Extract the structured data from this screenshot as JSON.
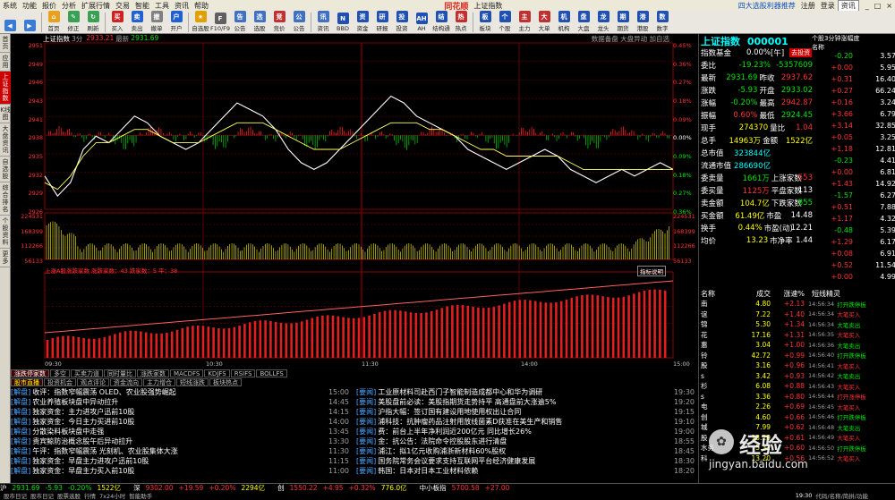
{
  "menubar": {
    "items": [
      "系统",
      "功能",
      "报价",
      "分析",
      "扩展行情",
      "交易",
      "智能",
      "工具",
      "资讯",
      "帮助"
    ],
    "logo": "同花顺",
    "title": "上证指数",
    "promo": "四大选股利器推荐",
    "right": [
      "注册",
      "登录"
    ],
    "search": "资讯"
  },
  "toolbar": {
    "buttons": [
      {
        "label": "",
        "name": "back-button",
        "color": "#3a7bd5",
        "glyph": "◀"
      },
      {
        "label": "",
        "name": "forward-button",
        "color": "#3a7bd5",
        "glyph": "▶"
      },
      {
        "label": "首页",
        "name": "home-button",
        "color": "#e8a020",
        "glyph": "⌂"
      },
      {
        "label": "修正",
        "name": "correct-button",
        "color": "#3aa055",
        "glyph": "✎"
      },
      {
        "label": "刷新",
        "name": "refresh-button",
        "color": "#3aa055",
        "glyph": "↻"
      },
      {
        "label": "买入",
        "name": "buy-button",
        "color": "#d02020",
        "glyph": "买"
      },
      {
        "label": "卖出",
        "name": "sell-button",
        "color": "#2060d0",
        "glyph": "卖"
      },
      {
        "label": "撤单",
        "name": "cancel-order-button",
        "color": "#808080",
        "glyph": "撤"
      },
      {
        "label": "开户",
        "name": "open-account-button",
        "color": "#2060d0",
        "glyph": "户"
      },
      {
        "label": "自选股",
        "name": "watchlist-button",
        "color": "#e0a000",
        "glyph": "★"
      },
      {
        "label": "F10/F9",
        "name": "f10-button",
        "color": "#606060",
        "glyph": "F"
      },
      {
        "label": "公告",
        "name": "announcement-button",
        "color": "#4070c0",
        "glyph": "告"
      },
      {
        "label": "选股",
        "name": "stock-picker-button",
        "color": "#4070c0",
        "glyph": "选"
      },
      {
        "label": "竞价",
        "name": "auction-button",
        "color": "#c03030",
        "glyph": "竞"
      },
      {
        "label": "公告",
        "name": "notice-button",
        "color": "#4070c0",
        "glyph": "公"
      },
      {
        "label": "资讯",
        "name": "info-button",
        "color": "#4070c0",
        "glyph": "讯"
      },
      {
        "label": "BBD",
        "name": "news-bbd-button",
        "color": "#2050b0",
        "glyph": "N"
      },
      {
        "label": "资金",
        "name": "funds-button",
        "color": "#2050b0",
        "glyph": "资"
      },
      {
        "label": "研报",
        "name": "report-button",
        "color": "#2050b0",
        "glyph": "研"
      },
      {
        "label": "投资",
        "name": "invest-button",
        "color": "#2050b0",
        "glyph": "投"
      },
      {
        "label": "AH",
        "name": "ah-button",
        "color": "#2050b0",
        "glyph": "AH"
      },
      {
        "label": "结构通",
        "name": "structure-button",
        "color": "#2050b0",
        "glyph": "结"
      },
      {
        "label": "热点",
        "name": "hotspot-button",
        "color": "#c03030",
        "glyph": "热"
      },
      {
        "label": "板块",
        "name": "sector-button",
        "color": "#2050b0",
        "glyph": "板"
      },
      {
        "label": "个股",
        "name": "stock-button",
        "color": "#2050b0",
        "glyph": "个"
      },
      {
        "label": "主力",
        "name": "main-force-button",
        "color": "#c03030",
        "glyph": "主"
      },
      {
        "label": "大单",
        "name": "big-order-button",
        "color": "#c03030",
        "glyph": "大"
      },
      {
        "label": "机构",
        "name": "institution-button",
        "color": "#2050b0",
        "glyph": "机"
      },
      {
        "label": "大盘",
        "name": "market-button",
        "color": "#2050b0",
        "glyph": "盘"
      },
      {
        "label": "龙头",
        "name": "leader-button",
        "color": "#2050b0",
        "glyph": "龙"
      },
      {
        "label": "期货",
        "name": "futures-button",
        "color": "#2050b0",
        "glyph": "期"
      },
      {
        "label": "港股",
        "name": "hk-button",
        "color": "#2050b0",
        "glyph": "港"
      },
      {
        "label": "数字",
        "name": "digital-button",
        "color": "#2050b0",
        "glyph": "数"
      }
    ]
  },
  "lefttabs": [
    {
      "label": "首页",
      "active": false
    },
    {
      "label": "应用",
      "active": false
    },
    {
      "label": "上证指数",
      "active": true
    },
    {
      "label": "K线图",
      "active": false
    },
    {
      "label": "大盘资讯",
      "active": false
    },
    {
      "label": "自选股",
      "active": false
    },
    {
      "label": "综合排名",
      "active": false
    },
    {
      "label": "个股资料",
      "active": false
    },
    {
      "label": "更多",
      "active": false
    }
  ],
  "chart_header": {
    "title": "上证指数",
    "period": "3分",
    "value": "2933.21",
    "latest_label": "最新",
    "latest": "2931.69",
    "right": "数据备盘 大盘异动 加自选"
  },
  "price_axis": {
    "left": [
      "2951",
      "2949",
      "2946",
      "2943",
      "2941",
      "2938",
      "2935",
      "2932",
      "2929",
      "2926"
    ],
    "right": [
      "0.45%",
      "0.36%",
      "0.27%",
      "0.18%",
      "0.09%",
      "0.00%",
      "0.09%",
      "0.18%",
      "0.27%",
      "0.36%"
    ]
  },
  "volume_axis": {
    "left": [
      "224531",
      "168399",
      "112266",
      "56133"
    ],
    "right": [
      "224531",
      "168399",
      "112266",
      "56133"
    ]
  },
  "indicator_header": {
    "text": "上涨A股涨跌家数 涨跌家数：43 跌家数：5 平：38",
    "button": "指标说明"
  },
  "time_axis": [
    "09:30",
    "10:30",
    "11:30",
    "14:00",
    "15:00"
  ],
  "chart_data": {
    "type": "line",
    "series": [
      {
        "name": "",
        "values": [
          2931,
          2928,
          2930,
          2935,
          2937,
          2936,
          2938,
          2940,
          2939,
          2937,
          2936,
          2935,
          2936,
          2938,
          2940,
          2942,
          2941,
          2940,
          2938,
          2935,
          2933,
          2932,
          2933,
          2935,
          2937,
          2939,
          2941,
          2943,
          2942,
          2940,
          2939,
          2938,
          2937,
          2935,
          2934,
          2933,
          2932,
          2933,
          2934,
          2935,
          2934,
          2932,
          2931,
          2930,
          2931,
          2932,
          2931,
          2932,
          2933,
          2932
        ]
      },
      {
        "name": "",
        "values": [
          2930,
          2929,
          2931,
          2934,
          2936,
          2936,
          2937,
          2938,
          2938,
          2937,
          2936,
          2936,
          2936,
          2937,
          2938,
          2939,
          2939,
          2939,
          2938,
          2937,
          2936,
          2935,
          2935,
          2935,
          2936,
          2937,
          2938,
          2939,
          2939,
          2939,
          2938,
          2938,
          2937,
          2936,
          2935,
          2935,
          2934,
          2934,
          2934,
          2934,
          2934,
          2933,
          2932,
          2932,
          2932,
          2932,
          2932,
          2932,
          2932,
          2932
        ]
      }
    ],
    "ylim": [
      2926,
      2951
    ]
  },
  "bottom_tabs": [
    "涨跌停家数",
    "多空",
    "买卖力道",
    "同时量比",
    "涨跌家数",
    "MACDFS",
    "KDJFS",
    "RSIFS",
    "BOLLFS"
  ],
  "sub_tabs": [
    "股市直播",
    "投资机会",
    "观点评论",
    "资金流向",
    "主力增仓",
    "短线涨跌",
    "板块热点"
  ],
  "news_left": [
    {
      "tag": "[解盘]",
      "text": "收评：指数窄幅震荡 OLED、农业股强势崛起",
      "time": "15:00"
    },
    {
      "tag": "[解盘]",
      "text": "农业养殖板块盘中异动拉升",
      "time": "14:45"
    },
    {
      "tag": "[解盘]",
      "text": "独家资金：主力进攻户迅前10股",
      "time": "14:15"
    },
    {
      "tag": "[解盘]",
      "text": "独家资金：今日主力买进前10股",
      "time": "14:00"
    },
    {
      "tag": "[解盘]",
      "text": "分散染料板块盘中走强",
      "time": "13:45"
    },
    {
      "tag": "[解盘]",
      "text": "贵宾鲸防治概念股午后异动拉升",
      "time": "13:30"
    },
    {
      "tag": "[解盘]",
      "text": "午评：指数窄幅震荡 光刻机、农业股集体大涨",
      "time": "11:30"
    },
    {
      "tag": "[解盘]",
      "text": "独家资金：早盘主力进攻户迅前10股",
      "time": "11:15"
    },
    {
      "tag": "[解盘]",
      "text": "独家资金：早盘主力买入前10股",
      "time": "11:00"
    }
  ],
  "news_right": [
    {
      "tag": "[要闻]",
      "text": "工业原材料司赴西门子智能制造成都中心和华为调研",
      "time": "19:30"
    },
    {
      "tag": "[要闻]",
      "text": "美股盘前必读：美股指期货走势持平 高通盘前大涨逾5%",
      "time": "19:20"
    },
    {
      "tag": "[要闻]",
      "text": "沪指大幅：签订国有建设用地使用权出让合同",
      "time": "19:15"
    },
    {
      "tag": "[要闻]",
      "text": "浦科技：抗肿瘤药品注射用放线菌素D获准在美生产和销售",
      "time": "19:10"
    },
    {
      "tag": "[要闻]",
      "text": "费：前台上半年净利润近200亿元 同比增长26%",
      "time": "19:00"
    },
    {
      "tag": "[要闻]",
      "text": "金：抗公告：法院命令控股股东进行清盘",
      "time": "18:55"
    },
    {
      "tag": "[要闻]",
      "text": "浦江：拟1亿元收购浦浙新材料60%股权",
      "time": "18:45"
    },
    {
      "tag": "[要闻]",
      "text": "国务院常务会议要求支持互联网平台经济健康发展",
      "time": "18:30"
    },
    {
      "tag": "[要闻]",
      "text": "韩国：日本对日本工业材料依赖",
      "time": "18:20"
    }
  ],
  "quote": {
    "title": "上证指数",
    "code": "000001",
    "rows": [
      {
        "l": "指数基金",
        "v": "0.00%",
        "u": "[午]",
        "extra": "去投资"
      },
      {
        "l": "委比",
        "v": "-19.23%",
        "v2": "-5357609"
      },
      {
        "l": "最新",
        "v": "2931.69",
        "l2": "昨收",
        "v2": "2937.62"
      },
      {
        "l": "涨跌",
        "v": "-5.93",
        "l2": "开盘",
        "v2": "2933.02"
      },
      {
        "l": "涨幅",
        "v": "-0.20%",
        "l2": "最高",
        "v2": "2942.87"
      },
      {
        "l": "振幅",
        "v": "0.60%",
        "l2": "最低",
        "v2": "2924.45"
      },
      {
        "l": "现手",
        "v": "274370",
        "l2": "量比",
        "v2": "1.04"
      },
      {
        "l": "总手",
        "v": "14963万",
        "l2": "金额",
        "v2": "1522亿"
      },
      {
        "l": "总市值",
        "v": "323844亿",
        "l2": "",
        "v2": ""
      },
      {
        "l": "流通市值",
        "v": "286690亿",
        "l2": "",
        "v2": ""
      },
      {
        "l": "委卖量",
        "v": "1661万",
        "l2": "上涨家数",
        "v2": "553"
      },
      {
        "l": "委买量",
        "v": "1125万",
        "l2": "平盘家数",
        "v2": "113"
      },
      {
        "l": "卖金额",
        "v": "104.7亿",
        "l2": "下跌家数",
        "v2": "855"
      },
      {
        "l": "买金额",
        "v": "61.49亿",
        "l2": "市盈",
        "v2": "14.48"
      },
      {
        "l": "换手",
        "v": "0.44%",
        "l2": "市盈(动)",
        "v2": "12.21"
      },
      {
        "l": "均价",
        "v": "13.23",
        "l2": "市净率",
        "v2": "1.44"
      }
    ]
  },
  "side_list": {
    "header": "个股3分钟涨幅度",
    "col_name": "名称",
    "rows": [
      [
        "-0.20",
        "3.57"
      ],
      [
        "+0.00",
        "5.95"
      ],
      [
        "+0.31",
        "16.40"
      ],
      [
        "+0.27",
        "66.24"
      ],
      [
        "+0.16",
        "3.24"
      ],
      [
        "+3.66",
        "6.79"
      ],
      [
        "+3.14",
        "32.85"
      ],
      [
        "+0.05",
        "3.25"
      ],
      [
        "+1.18",
        "12.81"
      ],
      [
        "-0.23",
        "4.41"
      ],
      [
        "+0.00",
        "6.81"
      ],
      [
        "+1.43",
        "14.92"
      ],
      [
        "-1.57",
        "6.27"
      ],
      [
        "+0.51",
        "7.88"
      ],
      [
        "+1.17",
        "4.32"
      ],
      [
        "-0.48",
        "5.39"
      ],
      [
        "+1.29",
        "6.17"
      ],
      [
        "+0.08",
        "6.91"
      ],
      [
        "+0.52",
        "11.54"
      ],
      [
        "+0.00",
        "4.99"
      ]
    ]
  },
  "trade_table": {
    "headers": [
      "名称",
      "成交",
      "涨速%"
    ],
    "col4": "短线精灵",
    "rows": [
      [
        "南",
        "4.80",
        "+2.13"
      ],
      [
        "谊",
        "7.22",
        "+1.40"
      ],
      [
        "锦",
        "5.30",
        "+1.34"
      ],
      [
        "花",
        "17.16",
        "+1.31"
      ],
      [
        "惠",
        "3.04",
        "+1.00"
      ],
      [
        "铃",
        "42.72",
        "+0.99"
      ],
      [
        "股",
        "3.16",
        "+0.96"
      ],
      [
        "s",
        "3.42",
        "+0.93"
      ],
      [
        "杉",
        "6.08",
        "+0.88"
      ],
      [
        "s",
        "3.36",
        "+0.80"
      ],
      [
        "电",
        "2.26",
        "+0.69"
      ],
      [
        "创",
        "4.60",
        "+0.66"
      ],
      [
        "城",
        "7.99",
        "+0.62"
      ],
      [
        "股",
        "13.19",
        "+0.61"
      ],
      [
        "水务",
        "5.32",
        "+0.60"
      ],
      [
        "科",
        "13.20",
        "+0.56"
      ]
    ]
  },
  "sprite_rows": [
    {
      "t": "14:56:34",
      "a": "打开跌停板"
    },
    {
      "t": "14:56:34",
      "a": "大笔买入"
    },
    {
      "t": "14:56:34",
      "a": "大笔卖出"
    },
    {
      "t": "14:56:35",
      "a": "大笔买入"
    },
    {
      "t": "14:56:36",
      "a": "大笔卖出"
    },
    {
      "t": "14:56:40",
      "a": "打开跌停板"
    },
    {
      "t": "14:56:41",
      "a": "大笔买入"
    },
    {
      "t": "14:56:42",
      "a": "大笔卖出"
    },
    {
      "t": "14:56:43",
      "a": "大笔买入"
    },
    {
      "t": "14:56:44",
      "a": "打开涨停板"
    },
    {
      "t": "14:56:45",
      "a": "大笔买入"
    },
    {
      "t": "14:56:46",
      "a": "打开跌停板"
    },
    {
      "t": "14:56:48",
      "a": "大笔卖出"
    },
    {
      "t": "14:56:49",
      "a": "大笔买入"
    },
    {
      "t": "14:56:50",
      "a": "打开跌停板"
    },
    {
      "t": "14:56:52",
      "a": "大笔买入"
    }
  ],
  "statusbar": {
    "items": [
      {
        "t": "沪",
        "c": "wht"
      },
      {
        "t": "2931.69",
        "c": "grn"
      },
      {
        "t": "-5.93",
        "c": "grn"
      },
      {
        "t": "-0.20%",
        "c": "grn"
      },
      {
        "t": "1522亿",
        "c": "yel"
      },
      {
        "t": "深",
        "c": "wht"
      },
      {
        "t": "9302.00",
        "c": "red"
      },
      {
        "t": "+19.59",
        "c": "red"
      },
      {
        "t": "+0.20%",
        "c": "red"
      },
      {
        "t": "2294亿",
        "c": "yel"
      },
      {
        "t": "创",
        "c": "wht"
      },
      {
        "t": "1550.22",
        "c": "red"
      },
      {
        "t": "+4.95",
        "c": "red"
      },
      {
        "t": "+0.32%",
        "c": "red"
      },
      {
        "t": "776.0亿",
        "c": "yel"
      },
      {
        "t": "中小板指",
        "c": "wht"
      },
      {
        "t": "5700.58",
        "c": "red"
      },
      {
        "t": "+27.00",
        "c": "red"
      }
    ],
    "bottom_links": [
      "股市日记",
      "股市日记",
      "股票选股",
      "行情",
      "7x24小时",
      "智能助手"
    ],
    "clock": "19:30",
    "extra": "代码/名称/简拼/功能"
  },
  "watermark": {
    "text": "经验",
    "sub": "jingyan.baidu.com"
  }
}
